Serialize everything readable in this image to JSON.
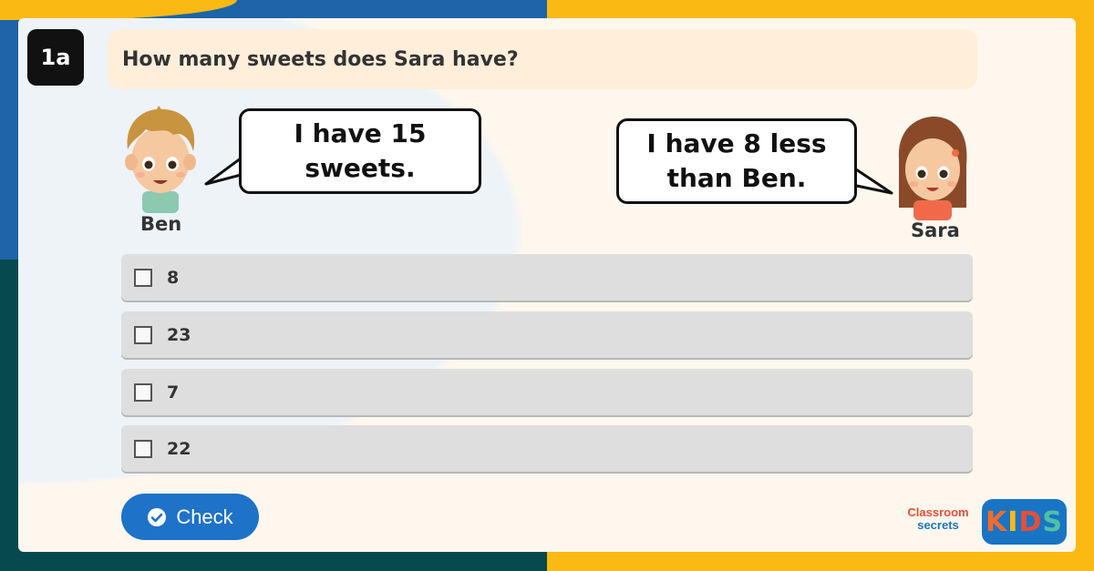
{
  "question": {
    "number": "1a",
    "text": "How many sweets does Sara have?"
  },
  "characters": [
    {
      "name": "Ben",
      "speech": [
        "I have 15",
        "sweets."
      ]
    },
    {
      "name": "Sara",
      "speech": [
        "I have 8 less",
        "than Ben."
      ]
    }
  ],
  "options": [
    {
      "label": "8",
      "checked": false
    },
    {
      "label": "23",
      "checked": false
    },
    {
      "label": "7",
      "checked": false
    },
    {
      "label": "22",
      "checked": false
    }
  ],
  "check_button": {
    "label": "Check",
    "icon": "check-circle-icon"
  },
  "branding": {
    "classroom_line1": "Classroom",
    "classroom_line2": "secrets",
    "kids": [
      "K",
      "I",
      "D",
      "S"
    ],
    "kids_colors": [
      "#f26b2a",
      "#fbb914",
      "#e84e36",
      "#4fc1a6"
    ]
  },
  "colors": {
    "accent_blue": "#1e72c8",
    "background_yellow": "#fbb914",
    "background_blue": "#1d64a8",
    "background_teal": "#064a4e",
    "question_panel": "#ffeeda"
  }
}
